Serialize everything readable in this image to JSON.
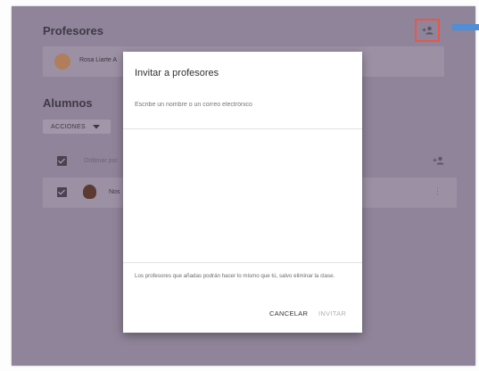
{
  "teachers": {
    "title": "Profesores",
    "items": [
      {
        "name": "Rosa Liarte A"
      }
    ]
  },
  "students": {
    "title": "Alumnos",
    "actions_label": "ACCIONES",
    "sort_label": "Ordenar por",
    "items": [
      {
        "name": "Nos"
      }
    ]
  },
  "dialog": {
    "title": "Invitar a profesores",
    "input_placeholder": "Escribe un nombre o un correo electrónico",
    "notice": "Los profesores que añadas podrán hacer lo mismo que tú, salvo eliminar la clase.",
    "cancel_label": "CANCELAR",
    "invite_label": "INVITAR"
  },
  "colors": {
    "accent_highlight": "#e8574a",
    "blue_tab": "#4f8ed8",
    "overlay": "#8f8499"
  },
  "icons": {
    "add_teacher": "person-add-icon",
    "add_student": "person-add-icon",
    "more": "more-vert-icon",
    "dropdown": "arrow-drop-down-icon"
  }
}
